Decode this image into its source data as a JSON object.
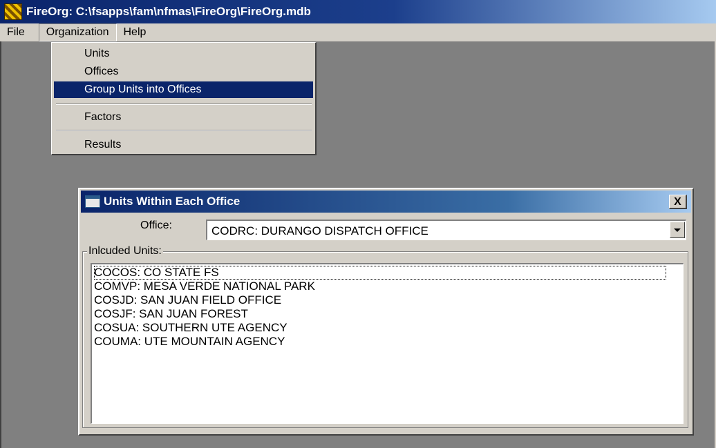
{
  "window": {
    "title": "FireOrg: C:\\fsapps\\fam\\nfmas\\FireOrg\\FireOrg.mdb",
    "icon": "fireorg-app-icon"
  },
  "menubar": {
    "items": [
      "File",
      "Organization",
      "Help"
    ]
  },
  "organization_menu": {
    "items": [
      "Units",
      "Offices",
      "Group Units into Offices",
      "Factors",
      "Results"
    ],
    "highlighted": "Group Units into Offices"
  },
  "dialog": {
    "title": "Units Within Each Office",
    "close_label": "X",
    "office_label": "Office:",
    "office_value": "CODRC: DURANGO DISPATCH OFFICE",
    "included_units_label": "Inlcuded Units:",
    "units": [
      "COCOS: CO STATE FS",
      "COMVP: MESA VERDE NATIONAL PARK",
      "COSJD: SAN JUAN FIELD OFFICE",
      "COSJF: SAN JUAN FOREST",
      "COSUA: SOUTHERN UTE AGENCY",
      "COUMA: UTE MOUNTAIN AGENCY"
    ]
  },
  "colors": {
    "titlebar": "#0a246a",
    "workspace": "#808080",
    "face": "#d4d0c8",
    "highlight": "#0a246a"
  }
}
